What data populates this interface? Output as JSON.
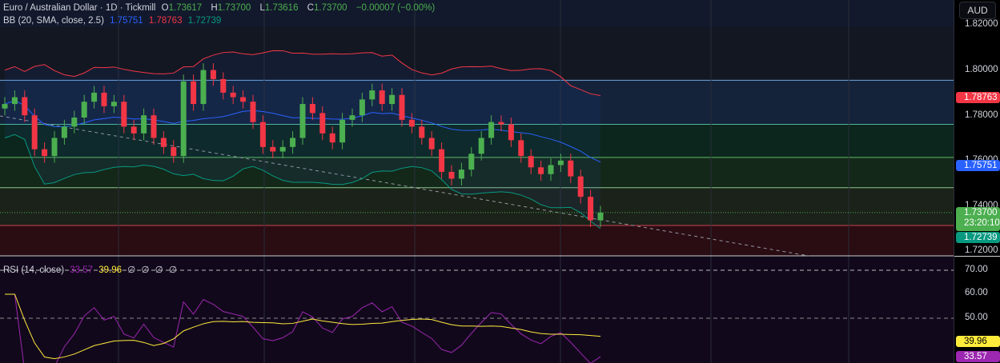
{
  "header": {
    "symbol": "Euro / Australian Dollar · 1D · Tickmill",
    "o_label": "O",
    "o": "1.73617",
    "h_label": "H",
    "h": "1.73700",
    "l_label": "L",
    "l": "1.73616",
    "c_label": "C",
    "c": "1.73700",
    "change": "−0.00007 (−0.00%)"
  },
  "bb": {
    "label": "BB (20, SMA, close, 2.5)",
    "basis": "1.75751",
    "upper": "1.78763",
    "lower": "1.72739"
  },
  "rsi": {
    "label": "RSI (14, close)",
    "value": "33.57",
    "ma": "39.96",
    "extras": [
      "∅",
      "∅",
      "∅",
      "∅"
    ]
  },
  "axis": {
    "currency": "AUD",
    "price_ticks": [
      "1.82000",
      "1.80000",
      "1.78000",
      "1.76000",
      "1.74000",
      "1.72000"
    ],
    "rsi_ticks": [
      "70.00",
      "60.00",
      "50.00"
    ],
    "tags": {
      "upper": "1.78763",
      "basis": "1.75751",
      "last": "1.73700",
      "countdown": "23:20:10",
      "lower": "1.72739",
      "rsi_ma": "39.96",
      "rsi": "33.57"
    }
  },
  "colors": {
    "up": "#4caf50",
    "down": "#f23645",
    "bb_upper": "#f23645",
    "bb_basis": "#2962ff",
    "bb_lower": "#089981",
    "rsi": "#9c27b0",
    "rsi_ma": "#ffeb3b"
  },
  "chart_data": {
    "type": "candlestick",
    "price_range": [
      1.717,
      1.822
    ],
    "rsi_range": [
      30,
      75
    ],
    "open_first": 1.783,
    "close": [
      1.785,
      1.788,
      1.78,
      1.765,
      1.762,
      1.77,
      1.775,
      1.779,
      1.786,
      1.79,
      1.784,
      1.786,
      1.775,
      1.772,
      1.78,
      1.77,
      1.766,
      1.762,
      1.795,
      1.785,
      1.8,
      1.796,
      1.79,
      1.788,
      1.786,
      1.777,
      1.766,
      1.764,
      1.766,
      1.77,
      1.785,
      1.781,
      1.772,
      1.768,
      1.778,
      1.78,
      1.787,
      1.791,
      1.785,
      1.789,
      1.778,
      1.775,
      1.77,
      1.765,
      1.755,
      1.752,
      1.756,
      1.763,
      1.77,
      1.777,
      1.776,
      1.769,
      1.762,
      1.757,
      1.754,
      1.758,
      1.76,
      1.753,
      1.744,
      1.7336,
      1.737
    ],
    "levels": [
      1.7955,
      1.776,
      1.7614,
      1.748,
      1.7313
    ]
  }
}
